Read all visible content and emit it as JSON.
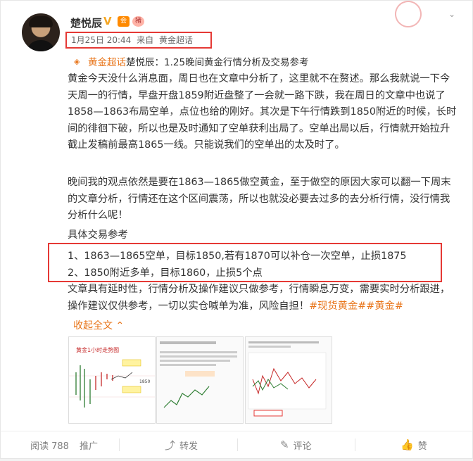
{
  "post": {
    "username": "楚悦辰",
    "badges": {
      "verified": "V",
      "level": "会",
      "pig": "猪"
    },
    "meta": {
      "date": "1月25日 20:44",
      "from": "来自",
      "source": "黄金超话"
    },
    "stamp_text": "印章",
    "topic_link": "黄金超话",
    "title_text": "楚悦辰：1.25晚间黄金行情分析及交易参考",
    "para1": "黄金今天没什么消息面，周日也在文章中分析了，这里就不在赘述。那么我就说一下今天周一的行情，早盘开盘1859附近盘整了一会就一路下跌，我在周日的文章中也说了1858—1863布局空单，点位也给的刚好。其次是下午行情跌到1850附近的时候，长时间的徘徊下破，所以也是及时通知了空单获利出局了。空单出局以后，行情就开始拉升截止发稿前最高1865一线。只能说我们的空单出的太及时了。",
    "para2": "晚间我的观点依然是要在1863—1865做空黄金，至于做空的原因大家可以翻一下周末的文章分析，行情还在这个区间震荡，所以也就没必要去过多的去分析行情，没行情我分析什么呢！",
    "para3": "具体交易参考",
    "trade1": "1、1863—1865空单，目标1850,若有1870可以补仓一次空单，止损1875",
    "trade2": "2、1850附近多单，目标1860，止损5个点",
    "para4": "文章具有延时性，行情分析及操作建议只做参考，行情瞬息万变，需要实时分析跟进，操作建议仅供参考，一切以实仓喊单为准，风险自担！",
    "hashtags": "#现货黄金##黄金#",
    "collapse": "收起全文",
    "thumb1_title": "黄金1小时走势图",
    "thumb1_labels": [
      "1850"
    ]
  },
  "actions": {
    "read": "阅读 788",
    "promote": "推广",
    "share": "转发",
    "comment": "评论",
    "like": "赞"
  },
  "colors": {
    "accent": "#e8751a",
    "highlight": "#e53935"
  }
}
